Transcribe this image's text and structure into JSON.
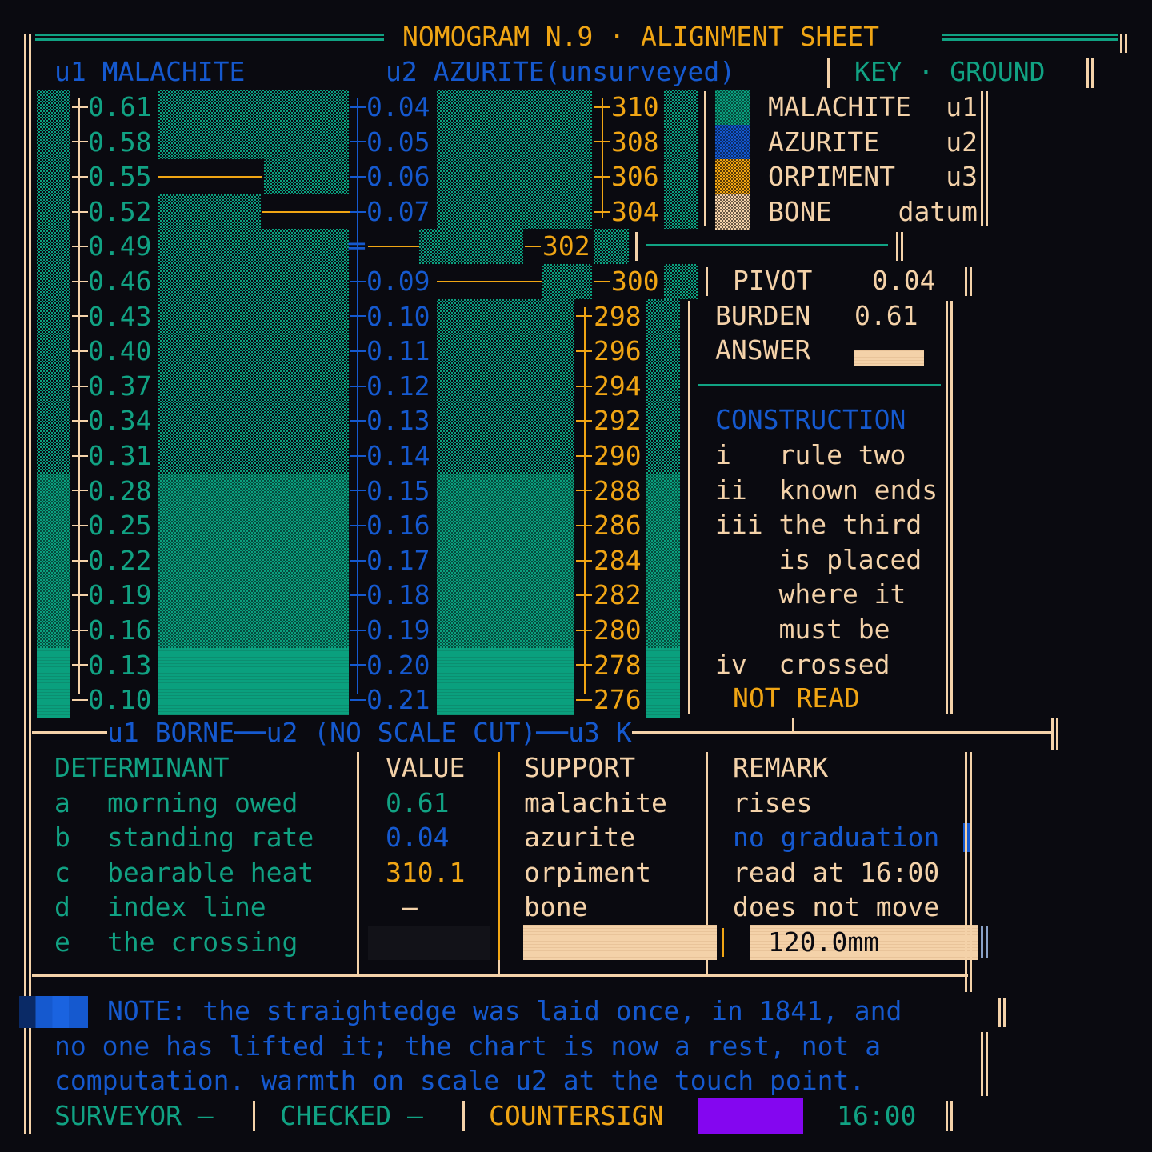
{
  "title": "NOMOGRAM N.9 · ALIGNMENT SHEET",
  "scales": {
    "u1_label": "u1 MALACHITE",
    "u2_label": "u2 AZURITE(unsurveyed)",
    "u1_ticks": [
      "0.61",
      "0.58",
      "0.55",
      "0.52",
      "0.49",
      "0.46",
      "0.43",
      "0.40",
      "0.37",
      "0.34",
      "0.31",
      "0.28",
      "0.25",
      "0.22",
      "0.19",
      "0.16",
      "0.13",
      "0.10"
    ],
    "u2_ticks": [
      "0.04",
      "0.05",
      "0.06",
      "0.07",
      "0.09",
      "0.10",
      "0.11",
      "0.12",
      "0.13",
      "0.14",
      "0.15",
      "0.16",
      "0.17",
      "0.18",
      "0.19",
      "0.20",
      "0.21"
    ],
    "u3_ticks": [
      "310",
      "308",
      "306",
      "304",
      "302",
      "300",
      "298",
      "296",
      "294",
      "292",
      "290",
      "288",
      "286",
      "284",
      "282",
      "280",
      "278",
      "276"
    ],
    "bottom_rule": "u1 BORNE──u2 (NO SCALE CUT)──u3 K"
  },
  "key": {
    "heading_left": "KEY",
    "heading_sep": "·",
    "heading_right": "GROUND",
    "rows": [
      {
        "name": "MALACHITE",
        "code": "u1",
        "color": "#0aa07e"
      },
      {
        "name": "AZURITE",
        "code": "u2",
        "color": "#1559cf"
      },
      {
        "name": "ORPIMENT",
        "code": "u3",
        "color": "#f0a514"
      },
      {
        "name": "BONE",
        "code": "datum",
        "color": "#f4d2a9"
      }
    ]
  },
  "readout": {
    "pivot_label": "PIVOT",
    "pivot_value": "0.04",
    "burden_label": "BURDEN",
    "burden_value": "0.61",
    "answer_label": "ANSWER"
  },
  "construction": {
    "heading": "CONSTRUCTION",
    "lines": [
      "i   rule two",
      "ii  known ends",
      "iii the third",
      "    is placed",
      "    where it",
      "    must be",
      "iv  crossed"
    ],
    "status": "NOT READ"
  },
  "table": {
    "headers": [
      "DETERMINANT",
      "VALUE",
      "SUPPORT",
      "REMARK"
    ],
    "rows": [
      {
        "key": "a",
        "name": "morning owed",
        "value": "0.61",
        "support": "malachite",
        "remark": "rises"
      },
      {
        "key": "b",
        "name": "standing rate",
        "value": "0.04",
        "support": "azurite",
        "remark": "no graduation"
      },
      {
        "key": "c",
        "name": "bearable heat",
        "value": "310.1",
        "support": "orpiment",
        "remark": "read at 16:00"
      },
      {
        "key": "d",
        "name": "index line",
        "value": "—",
        "support": "bone",
        "remark": "does not move"
      },
      {
        "key": "e",
        "name": "the crossing",
        "value": "",
        "support": "",
        "remark": "120.0mm"
      }
    ]
  },
  "note": {
    "line1": "NOTE: the straightedge was laid once, in 1841, and",
    "line2": "no one has lifted it; the chart is now a rest, not a",
    "line3": "computation. warmth on scale u2 at the touch point."
  },
  "footer": {
    "surveyor": "SURVEYOR —",
    "checked": "CHECKED —",
    "countersign": "COUNTERSIGN",
    "time": "16:00"
  },
  "colors": {
    "background": "#0a0a10",
    "malachite": "#11a283",
    "azurite": "#1559cf",
    "orpiment": "#f0a514",
    "bone": "#f4d2a9",
    "countersign": "#8406f0"
  }
}
